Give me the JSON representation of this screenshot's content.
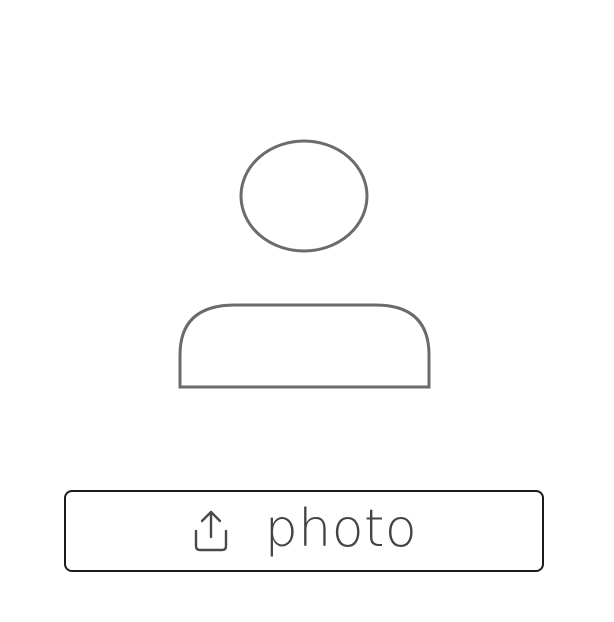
{
  "profile": {
    "avatar_icon": "user-placeholder-icon",
    "icon_color": "#6b6b6b"
  },
  "upload": {
    "icon": "upload-icon",
    "label": "photo",
    "border_color": "#1b1b1b"
  }
}
